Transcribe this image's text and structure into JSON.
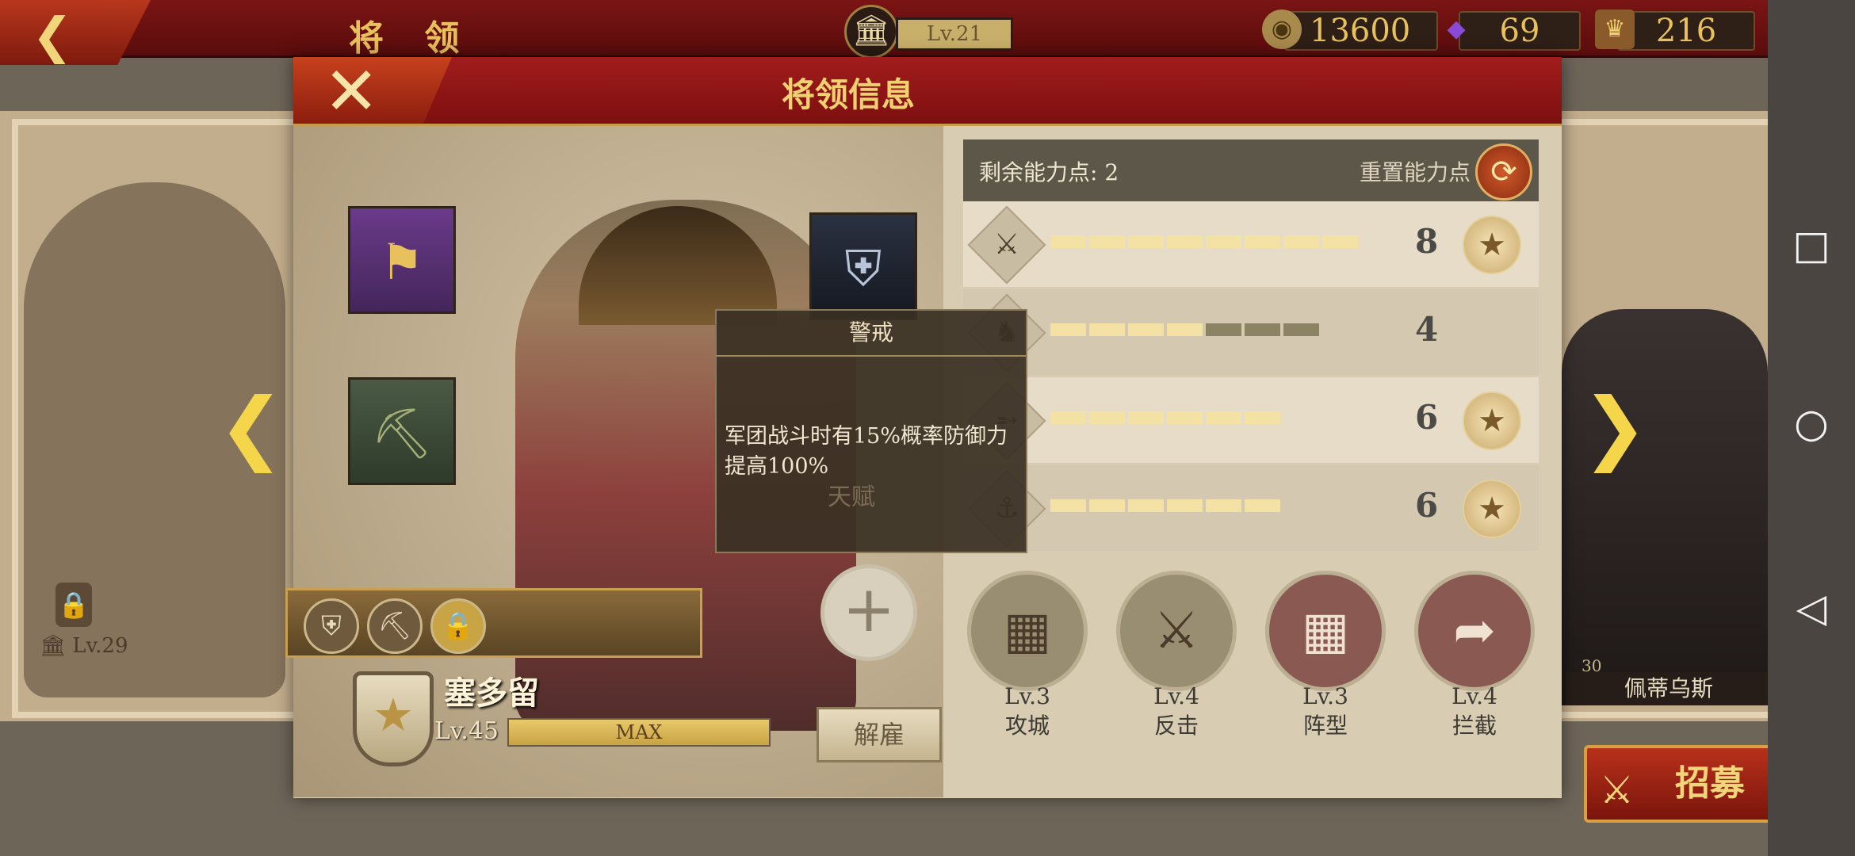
{
  "topbar": {
    "back_icon": "back-arrow-icon",
    "title": "将 领",
    "building_level": "Lv.21",
    "coins": "13600",
    "gems": "69",
    "tokens": "216",
    "plus_symbol": "+"
  },
  "dialog": {
    "title": "将领信息",
    "close_icon": "close-icon"
  },
  "hero": {
    "name": "塞多留",
    "level": "Lv.45",
    "exp_label": "MAX",
    "dismiss_label": "解雇"
  },
  "tooltip": {
    "title": "警戒",
    "description": "军团战斗时有15%概率防御力提高100%",
    "watermark": "天赋"
  },
  "stats": {
    "points_label": "剩余能力点: 2",
    "reset_label": "重置能力点",
    "rows": [
      {
        "icon": "sword-icon",
        "value": "8",
        "filled": 8,
        "total": 8,
        "badge": true
      },
      {
        "icon": "horse-icon",
        "value": "4",
        "filled": 4,
        "total": 7,
        "badge": false
      },
      {
        "icon": "arrows-icon",
        "value": "6",
        "filled": 6,
        "total": 6,
        "badge": true
      },
      {
        "icon": "anchor-icon",
        "value": "6",
        "filled": 6,
        "total": 6,
        "badge": true
      }
    ]
  },
  "abilities": [
    {
      "level": "Lv.3",
      "name": "攻城"
    },
    {
      "level": "Lv.4",
      "name": "反击"
    },
    {
      "level": "Lv.3",
      "name": "阵型"
    },
    {
      "level": "Lv.4",
      "name": "拦截"
    }
  ],
  "background": {
    "left_lv": "Lv.29",
    "right_name": "佩蒂乌斯",
    "right_lv": "30",
    "recruit_label": "招募"
  }
}
